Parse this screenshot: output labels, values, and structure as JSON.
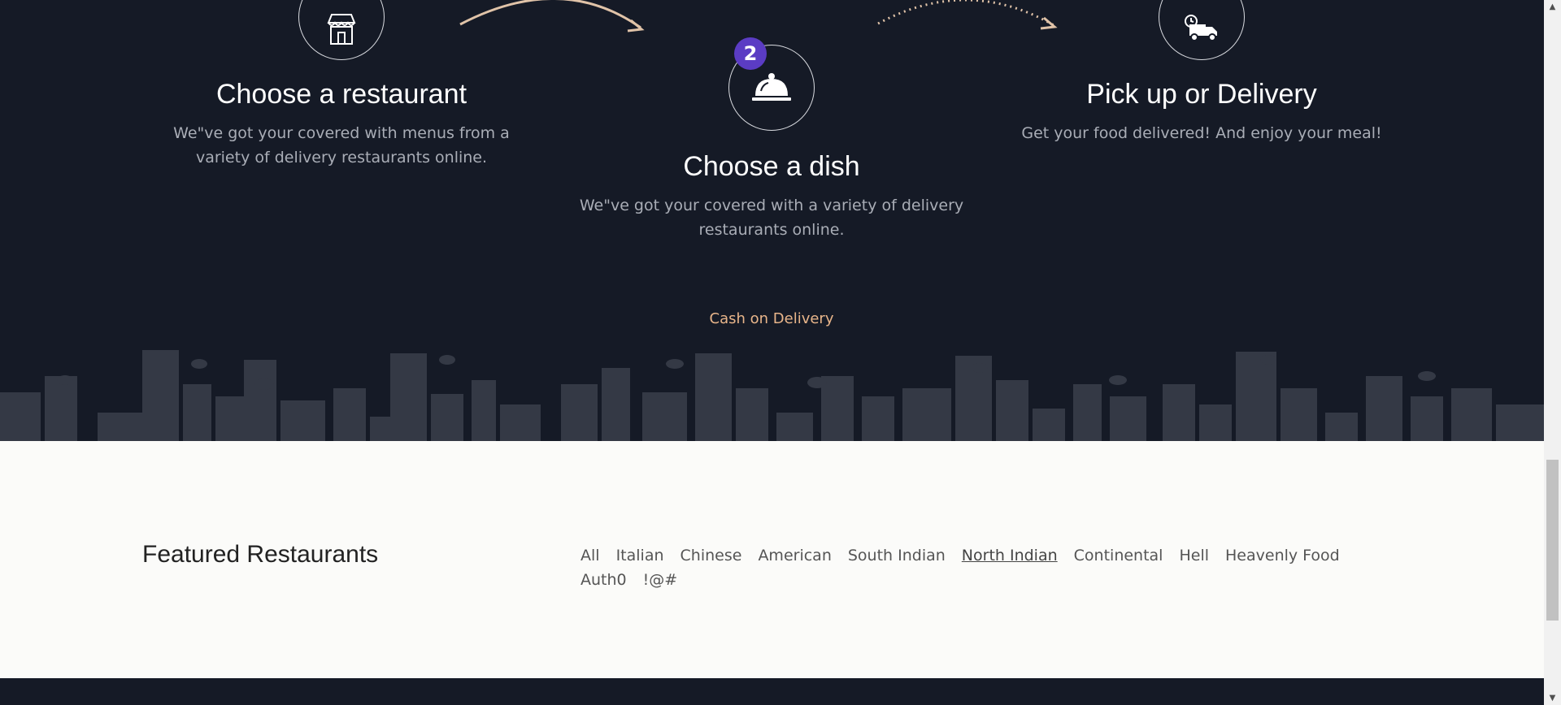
{
  "steps": [
    {
      "title": "Choose a restaurant",
      "desc_line1": "We\"ve got your covered with menus from a",
      "desc_line2": "variety of delivery restaurants online.",
      "icon": "store-icon"
    },
    {
      "title": "Choose a dish",
      "badge": "2",
      "desc_line1": "We\"ve got your covered with a variety of delivery",
      "desc_line2": "restaurants online.",
      "icon": "cloche-icon"
    },
    {
      "title": "Pick up or Delivery",
      "desc_line1": "Get your food delivered! And enjoy your meal!",
      "icon": "delivery-truck-icon"
    }
  ],
  "payment_text": "Cash on Delivery",
  "featured": {
    "title": "Featured Restaurants",
    "filters": [
      "All",
      "Italian",
      "Chinese",
      "American",
      "South Indian",
      "North Indian",
      "Continental",
      "Hell",
      "Heavenly Food",
      "Auth0",
      "!@#"
    ],
    "active_filter": "North Indian"
  },
  "colors": {
    "dark_bg": "#151a26",
    "accent": "#e8b58a",
    "badge": "#5b3cc4",
    "light_bg": "#fbfbf9"
  }
}
